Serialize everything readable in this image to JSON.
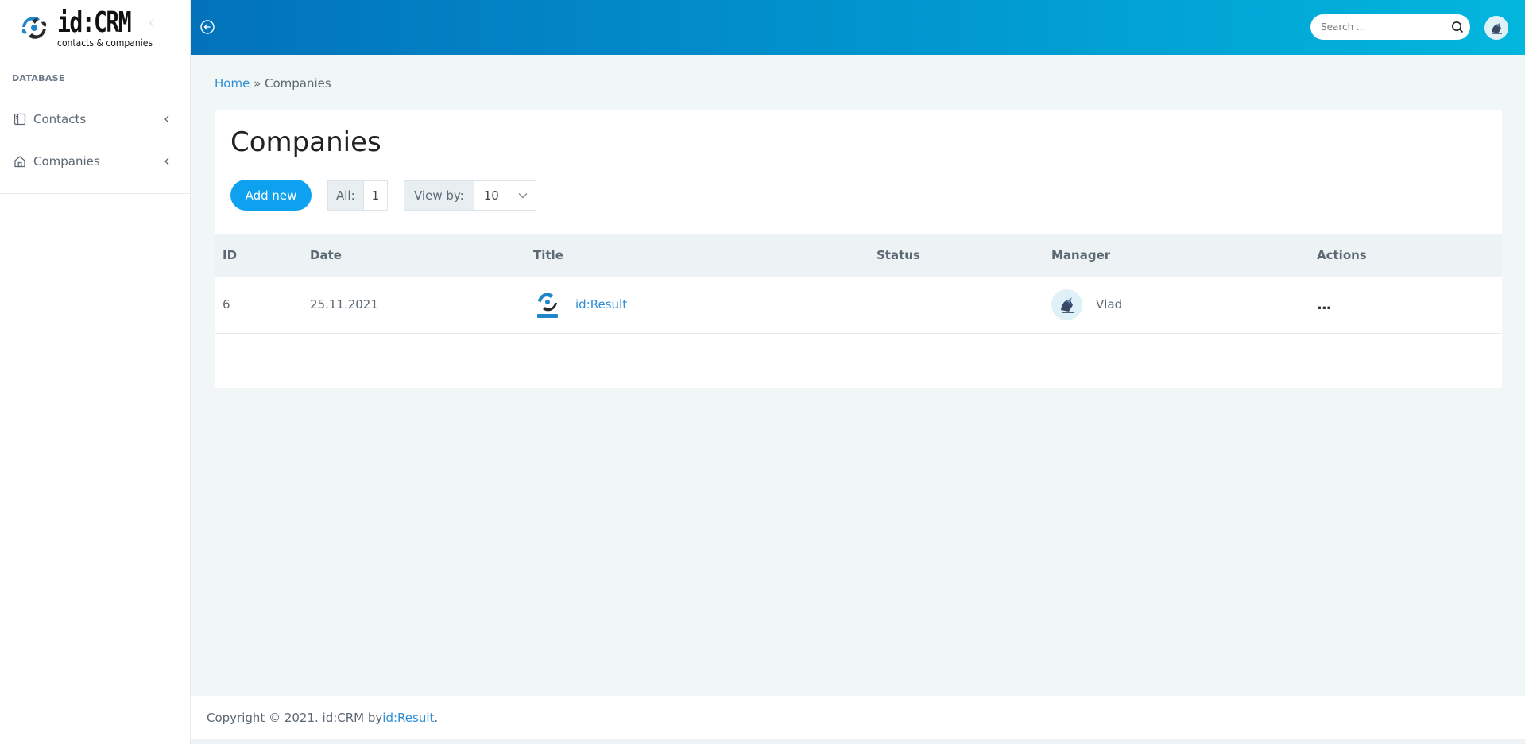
{
  "sidebar": {
    "logo_main": "id:CRM",
    "logo_sub": "contacts & companies",
    "section_label": "DATABASE",
    "items": [
      {
        "label": "Contacts",
        "icon": "sidebar-panel-icon"
      },
      {
        "label": "Companies",
        "icon": "home-icon"
      }
    ]
  },
  "header": {
    "search_placeholder": "Search ...",
    "colors": {
      "gradient_start": "#0272bb",
      "gradient_end": "#03b6dd"
    }
  },
  "breadcrumb": {
    "home": "Home",
    "separator": " » ",
    "current": "Companies"
  },
  "page": {
    "title": "Companies",
    "add_new_label": "Add new",
    "all_label": "All:",
    "all_count": "1",
    "view_by_label": "View by:",
    "view_by_value": "10"
  },
  "table": {
    "columns": [
      "ID",
      "Date",
      "Title",
      "Status",
      "Manager",
      "Actions"
    ],
    "rows": [
      {
        "id": "6",
        "date": "25.11.2021",
        "title": "id:Result",
        "status": "",
        "manager": "Vlad",
        "actions": "..."
      }
    ]
  },
  "footer": {
    "text": "Copyright © 2021. id:CRM by ",
    "link": "id:Result",
    "suffix": "."
  },
  "colors": {
    "accent": "#0da1f0",
    "link": "#2e8fd6",
    "background": "#f1f6f7"
  }
}
